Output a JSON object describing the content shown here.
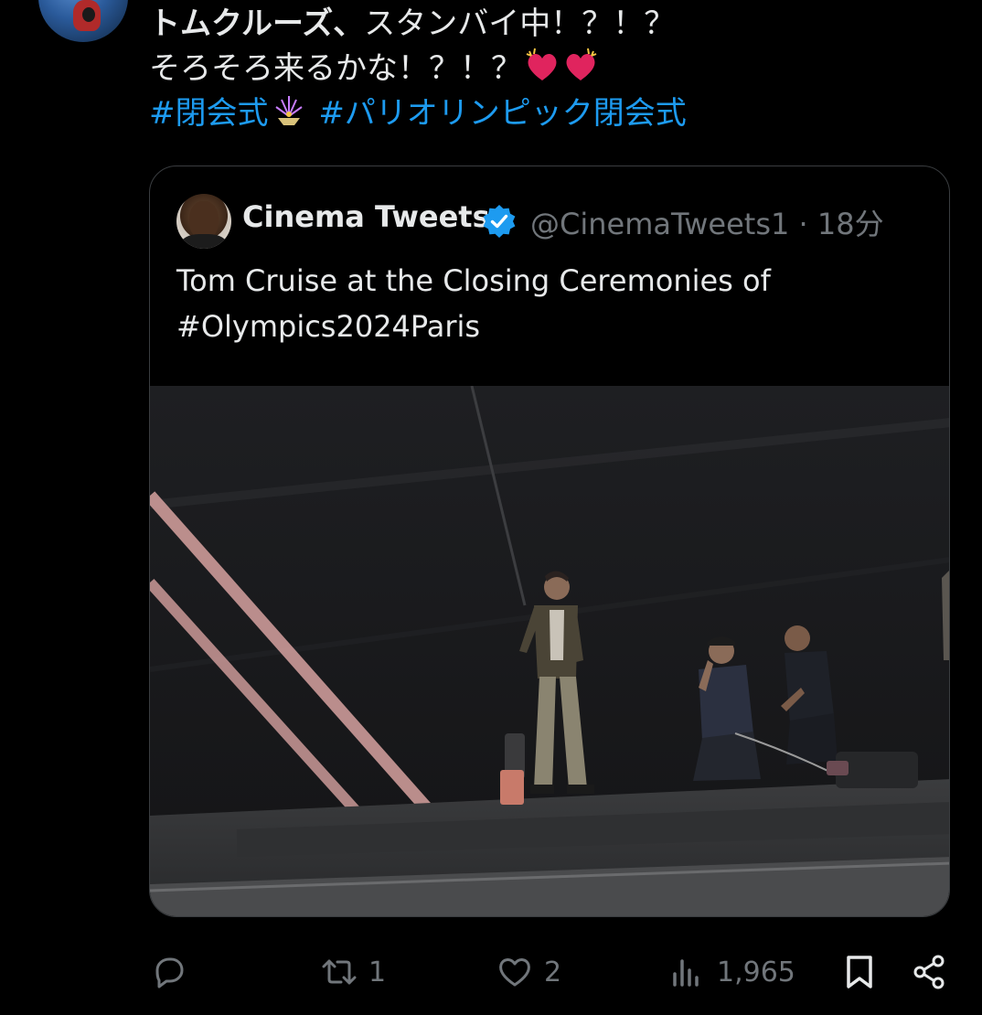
{
  "tweet": {
    "line1_bold": "トムクルーズ、",
    "line1_rest": "スタンバイ中！？！？",
    "line2": "そろそろ来るかな！？！？",
    "hashtag1": "#閉会式",
    "hashtag2": "#パリオリンピック閉会式"
  },
  "quote": {
    "author_name": "Cinema Tweets",
    "author_handle": "@CinemaTweets1",
    "separator": "·",
    "time": "18分",
    "body_line1": "Tom Cruise at the Closing Ceremonies of",
    "body_line2": "#Olympics2024Paris"
  },
  "actions": {
    "replies": "",
    "retweets": "1",
    "likes": "2",
    "views": "1,965"
  },
  "icons": {
    "reply": "reply-icon",
    "retweet": "retweet-icon",
    "like": "heart-icon",
    "views": "bar-chart-icon",
    "bookmark": "bookmark-icon",
    "share": "share-icon",
    "verified": "verified-badge-icon"
  },
  "colors": {
    "background": "#000000",
    "text": "#e7e9ea",
    "muted": "#71767b",
    "link": "#1d9bf0",
    "verified": "#1d9bf0",
    "heart": "#e0245e"
  }
}
